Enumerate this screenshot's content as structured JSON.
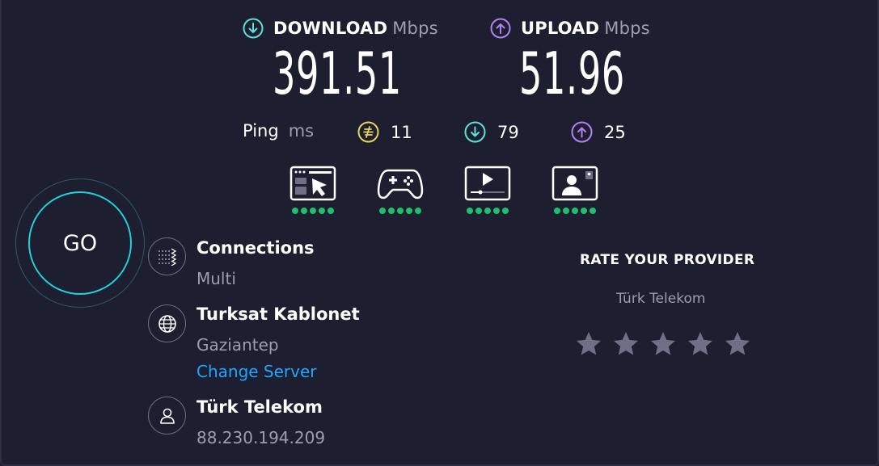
{
  "download": {
    "label": "DOWNLOAD",
    "unit": "Mbps",
    "value": "391.51",
    "icon": "arrow-down-circle-icon",
    "color": "#5fe0d6"
  },
  "upload": {
    "label": "UPLOAD",
    "unit": "Mbps",
    "value": "51.96",
    "icon": "arrow-up-circle-icon",
    "color": "#b480f5"
  },
  "ping": {
    "label": "Ping",
    "unit": "ms",
    "idle": "11",
    "download": "79",
    "upload": "25",
    "idle_color": "#e5d45d"
  },
  "experiences": [
    {
      "name": "web-browsing-icon",
      "rating": 5
    },
    {
      "name": "gaming-icon",
      "rating": 5
    },
    {
      "name": "video-streaming-icon",
      "rating": 5
    },
    {
      "name": "video-call-icon",
      "rating": 5
    }
  ],
  "go_button": {
    "label": "GO"
  },
  "connections": {
    "title": "Connections",
    "value": "Multi",
    "icon": "connections-icon"
  },
  "server": {
    "title": "Turksat Kablonet",
    "location": "Gaziantep",
    "change_label": "Change Server",
    "icon": "globe-icon"
  },
  "provider": {
    "title": "Türk Telekom",
    "ip": "88.230.194.209",
    "icon": "user-icon"
  },
  "rate": {
    "title": "RATE YOUR PROVIDER",
    "provider": "Türk Telekom",
    "stars": 5,
    "star_color": "#6e7087"
  },
  "colors": {
    "background": "#1d1e30",
    "accent": "#1fd3d8",
    "link": "#21a5ff",
    "good": "#1fc06b"
  }
}
